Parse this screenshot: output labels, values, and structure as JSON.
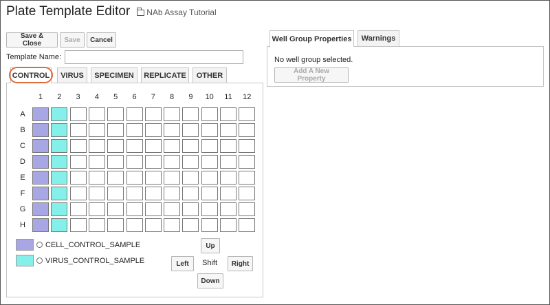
{
  "page": {
    "title": "Plate Template Editor",
    "folder": "NAb Assay Tutorial"
  },
  "toolbar": {
    "save_close": "Save & Close",
    "save": "Save",
    "cancel": "Cancel"
  },
  "template": {
    "label": "Template Name:",
    "value": ""
  },
  "tabs": [
    "CONTROL",
    "VIRUS",
    "SPECIMEN",
    "REPLICATE",
    "OTHER"
  ],
  "active_tab": "CONTROL",
  "plate": {
    "columns": [
      "1",
      "2",
      "3",
      "4",
      "5",
      "6",
      "7",
      "8",
      "9",
      "10",
      "11",
      "12"
    ],
    "rows": [
      "A",
      "B",
      "C",
      "D",
      "E",
      "F",
      "G",
      "H"
    ],
    "filled": {
      "1": "cell",
      "2": "virus"
    }
  },
  "legend": [
    {
      "label": "CELL_CONTROL_SAMPLE",
      "color": "#a9a6e6"
    },
    {
      "label": "VIRUS_CONTROL_SAMPLE",
      "color": "#85efe9"
    }
  ],
  "shift": {
    "label": "Shift",
    "up": "Up",
    "left": "Left",
    "right": "Right",
    "down": "Down"
  },
  "right_panel": {
    "tabs": [
      "Well Group Properties",
      "Warnings"
    ],
    "message": "No well group selected.",
    "add_property": "Add A New Property"
  }
}
